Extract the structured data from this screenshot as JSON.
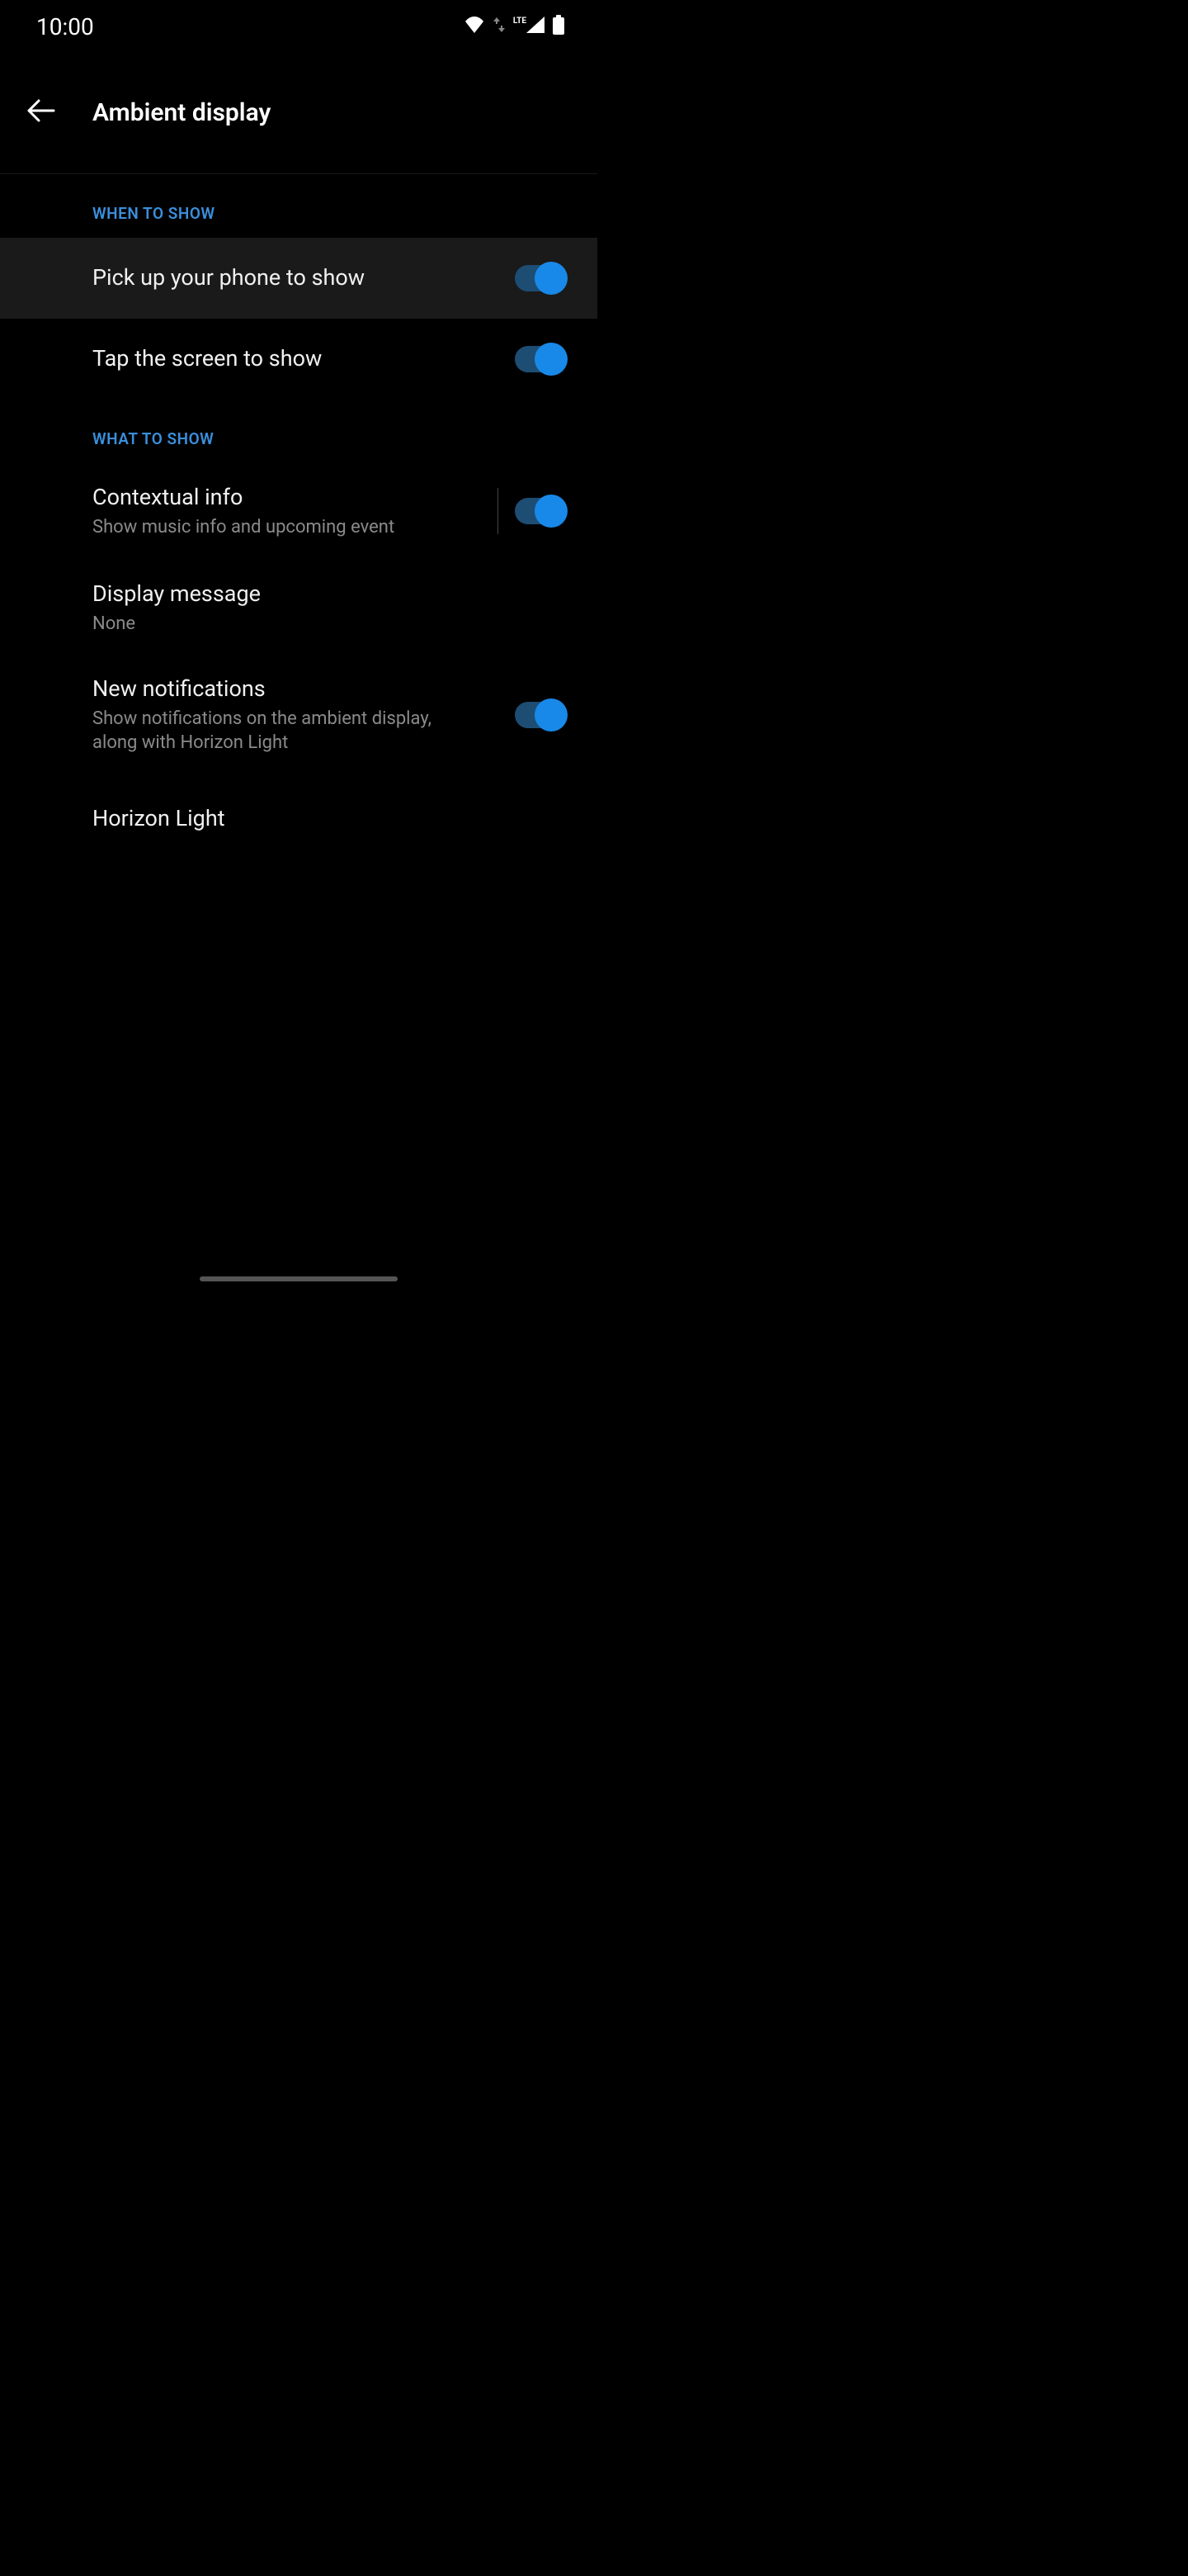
{
  "status": {
    "time": "10:00",
    "lte_label": "LTE"
  },
  "header": {
    "title": "Ambient display"
  },
  "sections": {
    "when_to_show": {
      "header": "WHEN TO SHOW",
      "items": {
        "pick_up": {
          "title": "Pick up your phone to show"
        },
        "tap_screen": {
          "title": "Tap the screen to show"
        }
      }
    },
    "what_to_show": {
      "header": "WHAT TO SHOW",
      "items": {
        "contextual": {
          "title": "Contextual info",
          "subtitle": "Show music info and upcoming event"
        },
        "display_message": {
          "title": "Display message",
          "subtitle": "None"
        },
        "new_notifications": {
          "title": "New notifications",
          "subtitle": "Show notifications on the ambient display, along with Horizon Light"
        },
        "horizon_light": {
          "title": "Horizon Light"
        }
      }
    }
  }
}
